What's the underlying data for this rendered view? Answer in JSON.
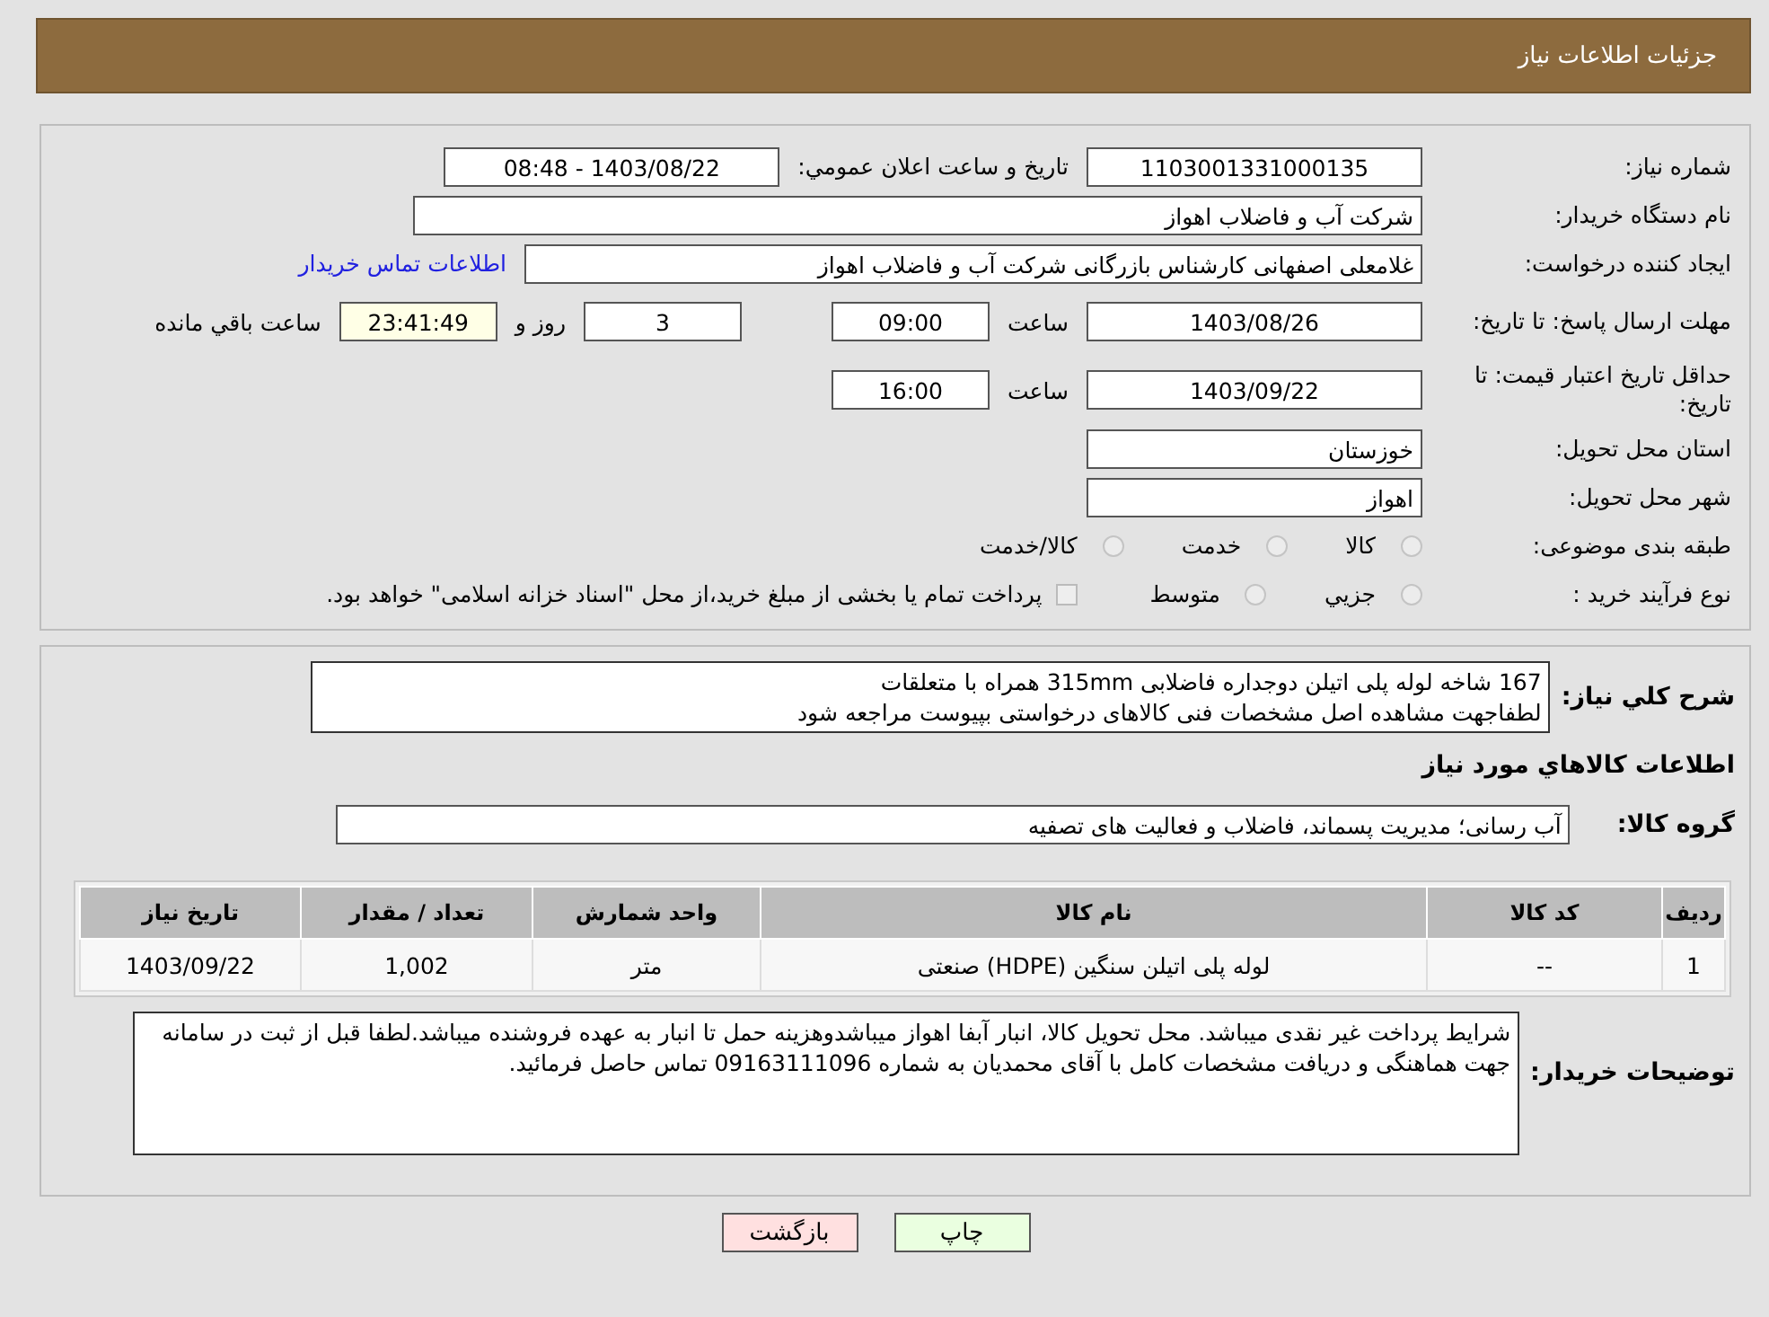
{
  "header": {
    "title": "جزئیات اطلاعات نیاز"
  },
  "need_number": {
    "label": "شماره نیاز:",
    "value": "1103001331000135"
  },
  "announce": {
    "label": "تاریخ و ساعت اعلان عمومي:",
    "value": "1403/08/22 - 08:48"
  },
  "buyer_org": {
    "label": "نام دستگاه خریدار:",
    "value": "شرکت آب و فاضلاب اهواز"
  },
  "requester": {
    "label": "ایجاد کننده درخواست:",
    "value": "غلامعلی اصفهانی کارشناس بازرگانی شرکت آب و فاضلاب اهواز",
    "link": "اطلاعات تماس خریدار"
  },
  "reply_deadline": {
    "label": "مهلت ارسال پاسخ: تا تاریخ:",
    "date": "1403/08/26",
    "time_label": "ساعت",
    "time": "09:00",
    "days": "3",
    "days_label": "روز و",
    "remaining": "23:41:49",
    "remaining_label": "ساعت باقي مانده"
  },
  "validity_deadline": {
    "label": "حداقل تاریخ اعتبار قیمت: تا تاریخ:",
    "date": "1403/09/22",
    "time_label": "ساعت",
    "time": "16:00"
  },
  "province": {
    "label": "استان محل تحویل:",
    "value": "خوزستان"
  },
  "city": {
    "label": "شهر محل تحویل:",
    "value": "اهواز"
  },
  "category": {
    "label": "طبقه بندی موضوعی:",
    "options": [
      {
        "label": "کالا",
        "selected": false
      },
      {
        "label": "خدمت",
        "selected": false
      },
      {
        "label": "کالا/خدمت",
        "selected": false
      }
    ]
  },
  "purchase_type": {
    "label": "نوع فرآیند خرید :",
    "options": [
      {
        "label": "جزيي",
        "selected": false
      },
      {
        "label": "متوسط",
        "selected": false
      }
    ],
    "payment_note": {
      "checked": false,
      "text": "پرداخت تمام یا بخشی از مبلغ خرید،از محل \"اسناد خزانه اسلامی\" خواهد بود."
    }
  },
  "description": {
    "label": "شرح كلي نياز:",
    "lines": [
      "167 شاخه لوله پلی اتیلن دوجداره فاضلابی 315mm همراه با متعلقات",
      "لطفاجهت مشاهده اصل مشخصات فنی کالاهای درخواستی بپیوست مراجعه شود"
    ]
  },
  "goods_title": "اطلاعات كالاهاي مورد نياز",
  "goods_group": {
    "label": "گروه کالا:",
    "value": "آب رسانی؛ مدیریت پسماند، فاضلاب و فعالیت های تصفیه"
  },
  "table": {
    "columns": [
      "ردیف",
      "کد کالا",
      "نام کالا",
      "واحد شمارش",
      "تعداد / مقدار",
      "تاریخ نیاز"
    ],
    "rows": [
      [
        "1",
        "--",
        "لوله پلی اتیلن سنگین (HDPE) صنعتی",
        "متر",
        "1,002",
        "1403/09/22"
      ]
    ]
  },
  "buyer_notes": {
    "label": "توضیحات خریدار:",
    "value": "شرایط پرداخت غیر نقدی میباشد. محل تحویل کالا، انبار آبفا اهواز میباشدوهزینه حمل تا انبار به عهده فروشنده میباشد.لطفا قبل از ثبت در سامانه جهت هماهنگی و دریافت مشخصات کامل با آقای  محمدیان به شماره 09163111096 تماس حاصل فرمائید."
  },
  "buttons": [
    {
      "label": "چاپ",
      "kind": "print"
    },
    {
      "label": "بازگشت",
      "kind": "back"
    }
  ]
}
